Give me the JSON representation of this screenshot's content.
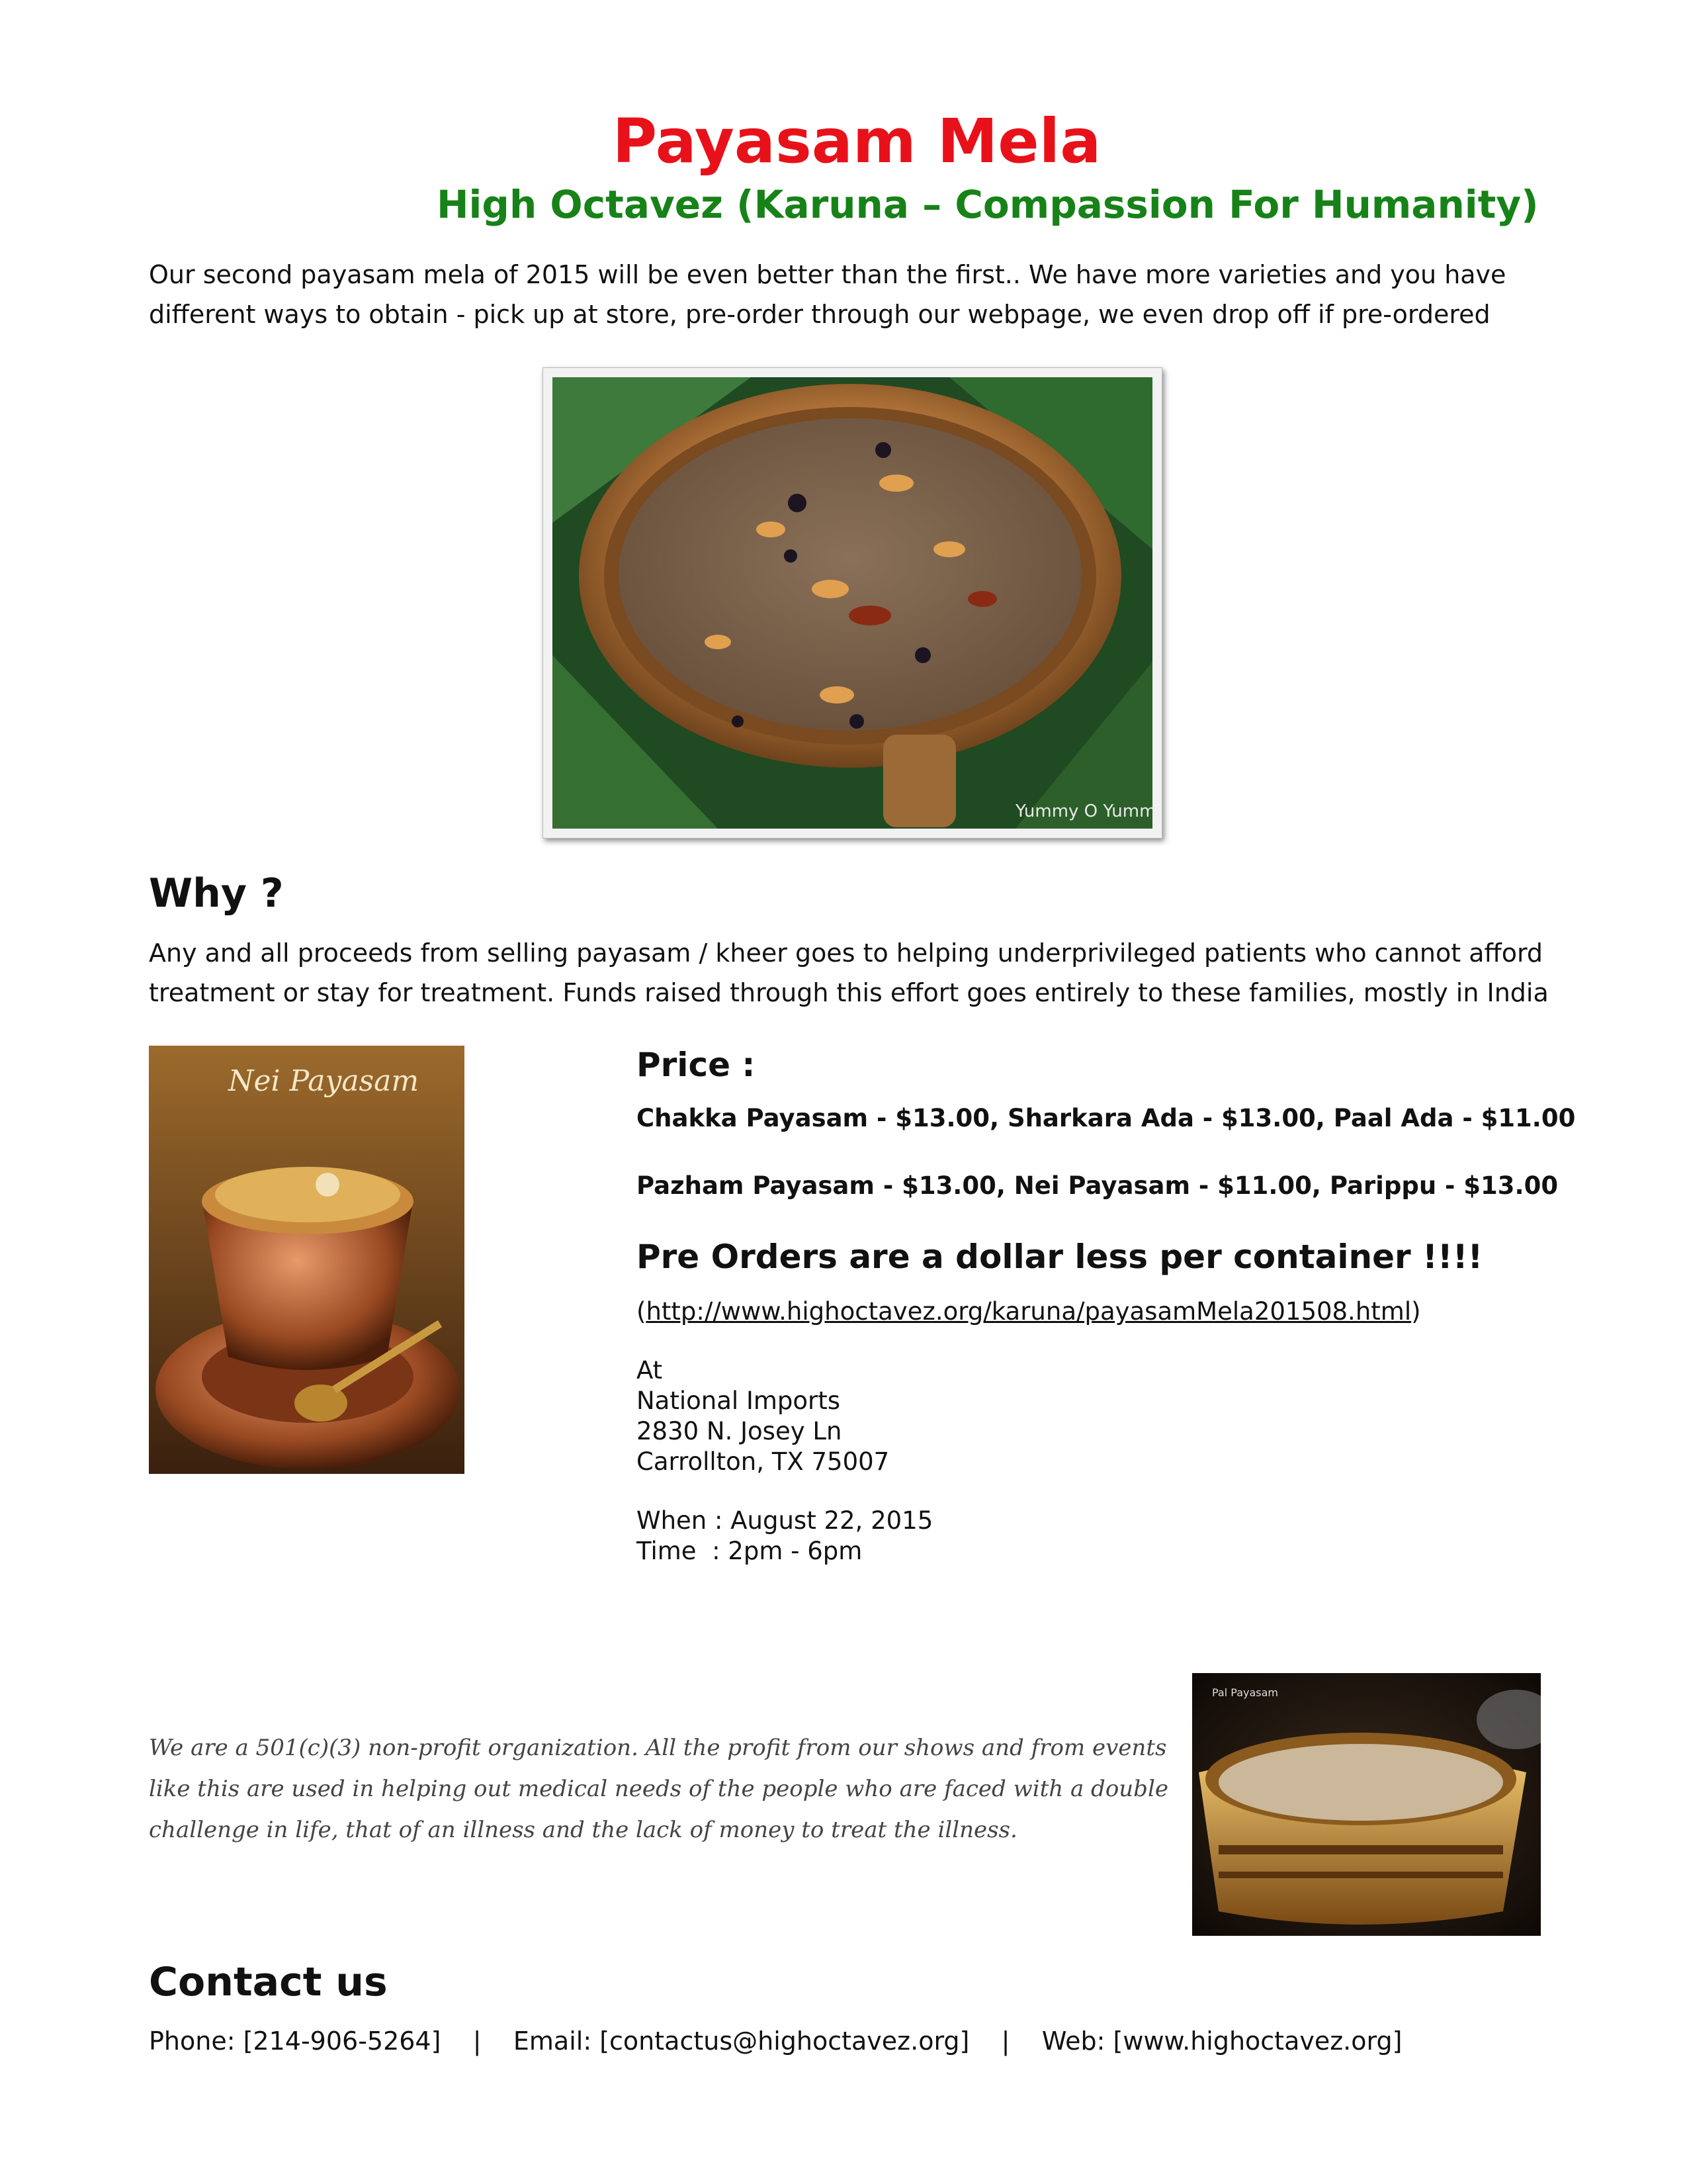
{
  "title": "Payasam Mela",
  "subtitle": "High Octavez (Karuna – Compassion For Humanity)",
  "intro": "Our second payasam mela of 2015 will be even better than the first.. We have more varieties and you have different ways to obtain - pick up at store, pre-order through our webpage, we even drop off if pre-ordered",
  "images": {
    "main_watermark": "Yummy O Yummy",
    "nei_label": "Nei Payasam",
    "pal_label": "Pal Payasam"
  },
  "why": {
    "heading": "Why ?",
    "body": "Any and all proceeds from selling  payasam / kheer goes to helping underprivileged patients who cannot afford treatment or stay for treatment. Funds raised through this effort goes entirely to these families, mostly in India"
  },
  "price": {
    "heading": "Price :",
    "line1": "Chakka Payasam - $13.00, Sharkara Ada - $13.00, Paal Ada - $11.00",
    "line2": "Pazham Payasam - $13.00, Nei Payasam - $11.00, Parippu  - $13.00"
  },
  "preorder": {
    "text": "Pre Orders are a dollar less per container !!!!",
    "url_open": "(",
    "url": "http://www.highoctavez.org/karuna/payasamMela201508.html",
    "url_close": ")"
  },
  "location": {
    "at": "At",
    "name": "National Imports",
    "street": "2830 N. Josey Ln",
    "city": "Carrollton, TX 75007"
  },
  "schedule": {
    "when": "When : August 22, 2015",
    "time": "Time  : 2pm - 6pm"
  },
  "nonprofit": "We are a 501(c)(3) non-profit organization. All the profit from our shows and from events like this are used in helping out medical needs of the people who are faced with a double challenge in life, that of an illness and the lack of money to treat the illness.",
  "contact": {
    "heading": "Contact us",
    "phone": "Phone: [214-906-5264]",
    "email": "Email: [contactus@highoctavez.org]",
    "web": "Web: [www.highoctavez.org]",
    "separator": "|"
  },
  "colors": {
    "title": "#e8111a",
    "subtitle": "#178218",
    "text": "#111111"
  }
}
